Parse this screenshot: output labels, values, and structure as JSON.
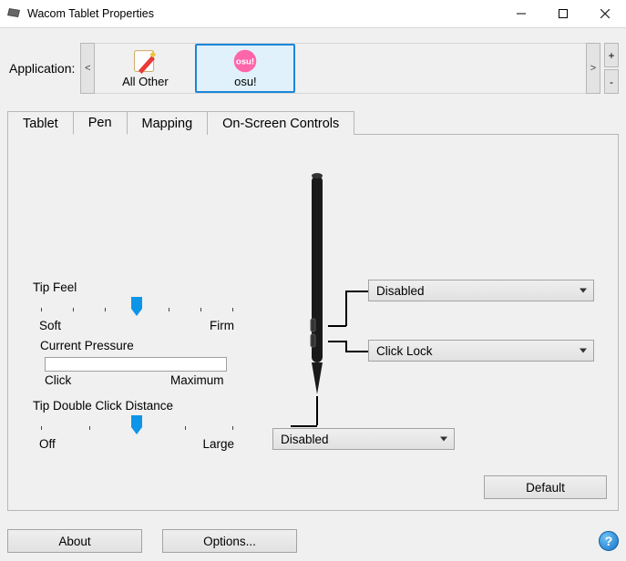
{
  "window": {
    "title": "Wacom Tablet Properties"
  },
  "application": {
    "label": "Application:",
    "items": [
      {
        "name": "All Other"
      },
      {
        "name": "osu!"
      }
    ],
    "selected_index": 1
  },
  "tabs": {
    "items": [
      "Tablet",
      "Pen",
      "Mapping",
      "On-Screen Controls"
    ],
    "selected": "Pen"
  },
  "pen": {
    "tipFeel": {
      "title": "Tip Feel",
      "min": "Soft",
      "max": "Firm",
      "value": 3,
      "ticks": 7
    },
    "currentPressure": {
      "title": "Current Pressure",
      "min": "Click",
      "max": "Maximum",
      "value": 0
    },
    "doubleClick": {
      "title": "Tip Double Click Distance",
      "min": "Off",
      "max": "Large",
      "value": 2,
      "ticks": 5
    },
    "upperSideBtn": "Disabled",
    "lowerSideBtn": "Click Lock",
    "tipBtn": "Disabled",
    "defaultBtn": "Default"
  },
  "bottom": {
    "about": "About",
    "options": "Options..."
  }
}
